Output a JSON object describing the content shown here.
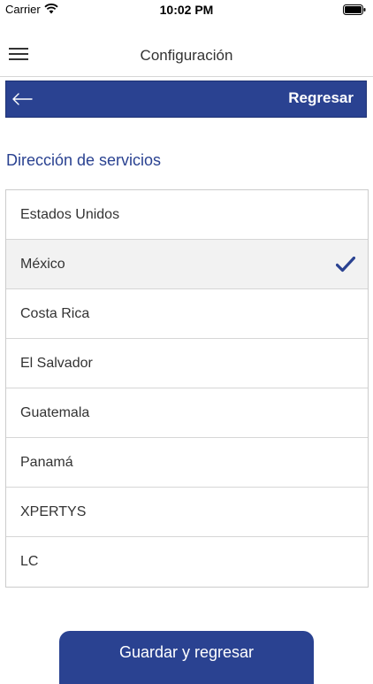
{
  "status_bar": {
    "carrier": "Carrier",
    "time": "10:02 PM",
    "icons": [
      "wifi-icon",
      "battery-icon"
    ]
  },
  "header": {
    "title": "Configuración",
    "menu_icon": "menu-icon"
  },
  "back_bar": {
    "label": "Regresar",
    "icon": "back-arrow-icon",
    "color": "#2a4291"
  },
  "section": {
    "title": "Dirección de servicios"
  },
  "countries": {
    "items": [
      {
        "label": "Estados Unidos",
        "selected": false
      },
      {
        "label": "México",
        "selected": true
      },
      {
        "label": "Costa Rica",
        "selected": false
      },
      {
        "label": "El Salvador",
        "selected": false
      },
      {
        "label": "Guatemala",
        "selected": false
      },
      {
        "label": "Panamá",
        "selected": false
      },
      {
        "label": "XPERTYS",
        "selected": false
      },
      {
        "label": "LC",
        "selected": false
      }
    ],
    "check_icon": "check-icon"
  },
  "footer": {
    "save_label": "Guardar y regresar"
  },
  "colors": {
    "primary": "#2a4291",
    "selected_bg": "#f2f2f2"
  }
}
